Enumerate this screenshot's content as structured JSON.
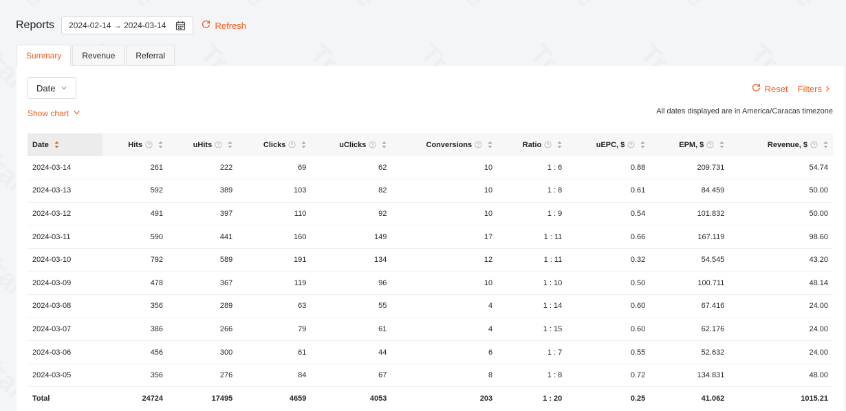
{
  "header": {
    "title": "Reports",
    "date_range": "2024-02-14 → 2024-03-14",
    "refresh_label": "Refresh"
  },
  "tabs": [
    {
      "label": "Summary",
      "active": true
    },
    {
      "label": "Revenue",
      "active": false
    },
    {
      "label": "Referral",
      "active": false
    }
  ],
  "toolbar": {
    "group_by": "Date",
    "show_chart": "Show chart",
    "reset": "Reset",
    "filters": "Filters",
    "timezone_note": "All dates displayed are in America/Caracas timezone"
  },
  "watermark": "Traiee",
  "table": {
    "columns": [
      {
        "label": "Date",
        "help": false
      },
      {
        "label": "Hits",
        "help": true
      },
      {
        "label": "uHits",
        "help": true
      },
      {
        "label": "Clicks",
        "help": true
      },
      {
        "label": "uClicks",
        "help": true
      },
      {
        "label": "Conversions",
        "help": true
      },
      {
        "label": "Ratio",
        "help": true
      },
      {
        "label": "uEPC, $",
        "help": true
      },
      {
        "label": "EPM, $",
        "help": true
      },
      {
        "label": "Revenue, $",
        "help": true
      }
    ],
    "rows": [
      [
        "2024-03-14",
        "261",
        "222",
        "69",
        "62",
        "10",
        "1 : 6",
        "0.88",
        "209.731",
        "54.74"
      ],
      [
        "2024-03-13",
        "592",
        "389",
        "103",
        "82",
        "10",
        "1 : 8",
        "0.61",
        "84.459",
        "50.00"
      ],
      [
        "2024-03-12",
        "491",
        "397",
        "110",
        "92",
        "10",
        "1 : 9",
        "0.54",
        "101.832",
        "50.00"
      ],
      [
        "2024-03-11",
        "590",
        "441",
        "160",
        "149",
        "17",
        "1 : 11",
        "0.66",
        "167.119",
        "98.60"
      ],
      [
        "2024-03-10",
        "792",
        "589",
        "191",
        "134",
        "12",
        "1 : 11",
        "0.32",
        "54.545",
        "43.20"
      ],
      [
        "2024-03-09",
        "478",
        "367",
        "119",
        "96",
        "10",
        "1 : 10",
        "0.50",
        "100.711",
        "48.14"
      ],
      [
        "2024-03-08",
        "356",
        "289",
        "63",
        "55",
        "4",
        "1 : 14",
        "0.60",
        "67.416",
        "24.00"
      ],
      [
        "2024-03-07",
        "386",
        "266",
        "79",
        "61",
        "4",
        "1 : 15",
        "0.60",
        "62.176",
        "24.00"
      ],
      [
        "2024-03-06",
        "456",
        "300",
        "61",
        "44",
        "6",
        "1 : 7",
        "0.55",
        "52.632",
        "24.00"
      ],
      [
        "2024-03-05",
        "356",
        "276",
        "84",
        "67",
        "8",
        "1 : 8",
        "0.72",
        "134.831",
        "48.00"
      ]
    ],
    "total": [
      "Total",
      "24724",
      "17495",
      "4659",
      "4053",
      "203",
      "1 : 20",
      "0.25",
      "41.062",
      "1015.21"
    ]
  },
  "colors": {
    "accent": "#f25c1f",
    "background": "#f4f5f7",
    "header_bg": "#f7f7f7"
  }
}
